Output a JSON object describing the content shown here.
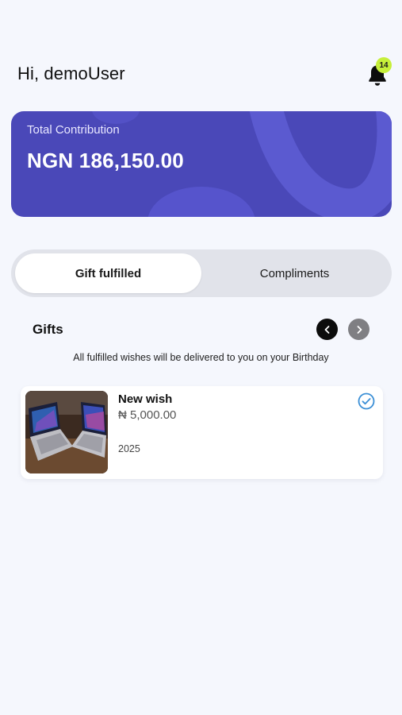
{
  "header": {
    "greeting": "Hi, demoUser",
    "notification_count": "14"
  },
  "contribution": {
    "label": "Total Contribution",
    "amount": "NGN 186,150.00"
  },
  "tabs": [
    {
      "label": "Gift fulfilled",
      "active": true
    },
    {
      "label": "Compliments",
      "active": false
    }
  ],
  "gifts": {
    "title": "Gifts",
    "info": "All fulfilled wishes will be delivered to you on your Birthday",
    "items": [
      {
        "name": "New wish",
        "price": "₦ 5,000.00",
        "year": "2025",
        "image_icon": "laptops-photo",
        "status_icon": "check-circle-icon"
      }
    ]
  },
  "colors": {
    "card_bg": "#4a48b8",
    "badge": "#c6ef3a",
    "check": "#3b8fd6",
    "page_bg": "#f5f7fd"
  }
}
